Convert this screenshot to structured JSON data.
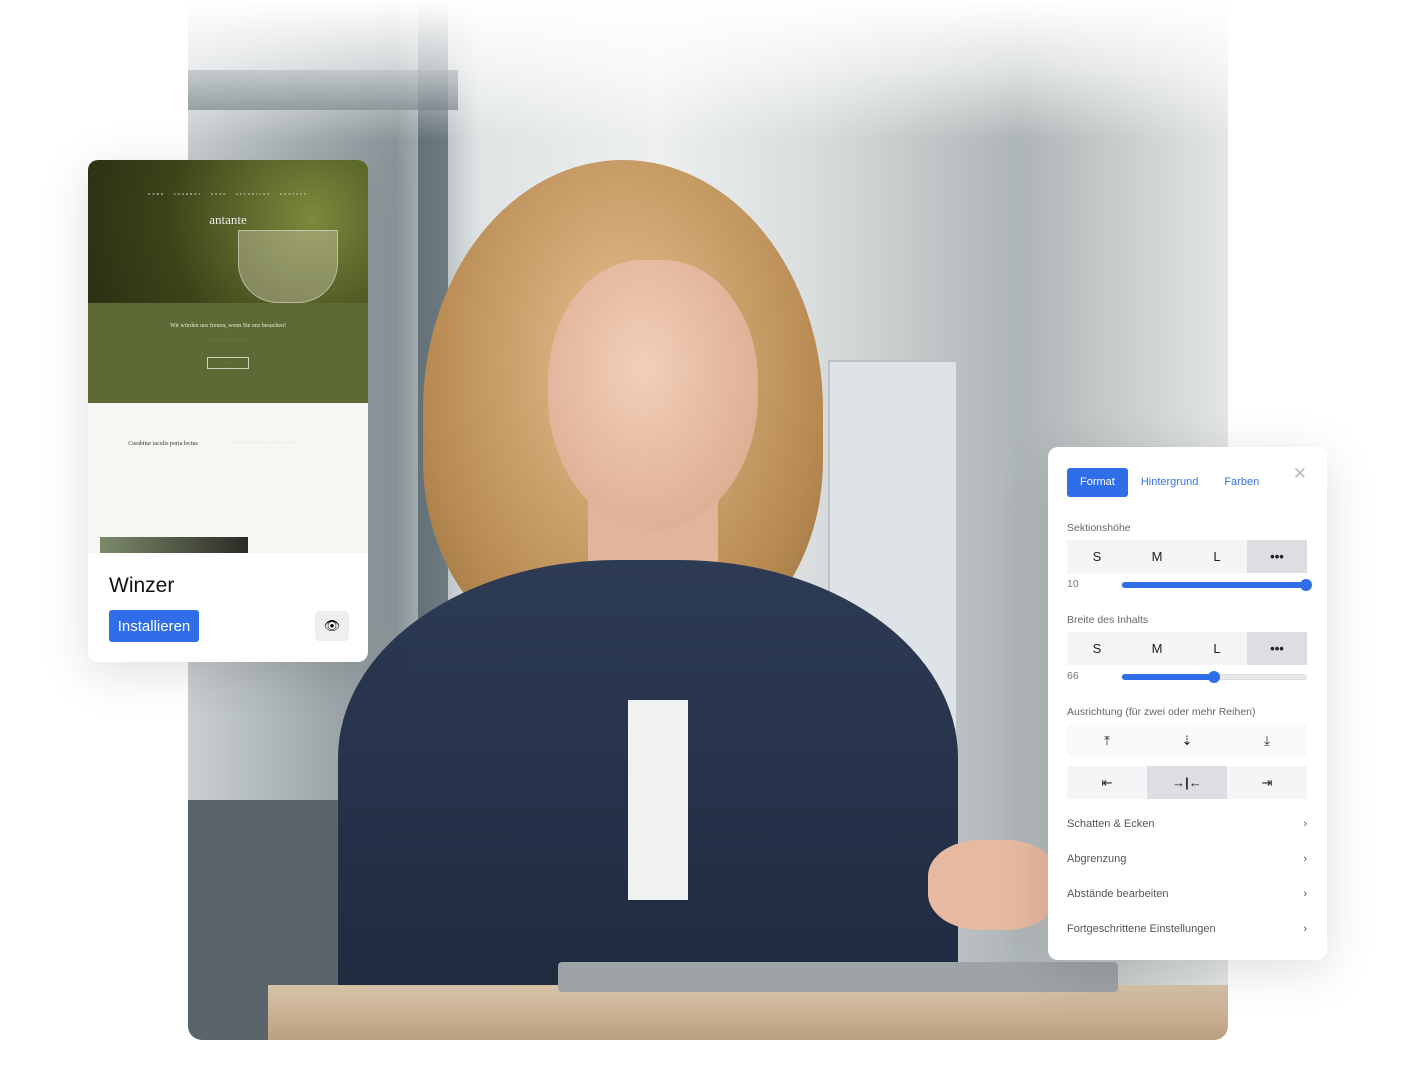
{
  "theme_card": {
    "preview": {
      "logo": "antante",
      "nav": "HOME · ANGEBOT · SHOP · AKTUELLES · KONTAKT",
      "headline": "Wir würden uns freuen, wenn Sie uns besuchen!",
      "section_title": "Curabitur iaculis porta lectus"
    },
    "name": "Winzer",
    "install_label": "Installieren",
    "preview_icon": "eye-icon"
  },
  "panel": {
    "tabs": [
      {
        "label": "Format",
        "active": true
      },
      {
        "label": "Hintergrund"
      },
      {
        "label": "Farben"
      }
    ],
    "close_icon": "close-icon",
    "section_height": {
      "label": "Sektionshöhe",
      "options": [
        "S",
        "M",
        "L",
        "•••"
      ],
      "selected": "•••",
      "value": "10",
      "slider_fraction": 1.0
    },
    "content_width": {
      "label": "Breite des Inhalts",
      "options": [
        "S",
        "M",
        "L",
        "•••"
      ],
      "selected": "•••",
      "value": "66",
      "slider_fraction": 0.5
    },
    "alignment": {
      "label": "Ausrichtung (für zwei oder mehr Reihen)",
      "vertical": [
        "align-top-icon",
        "align-middle-icon",
        "align-bottom-icon"
      ],
      "horizontal": [
        "align-left-icon",
        "align-center-icon",
        "align-right-icon"
      ],
      "horizontal_selected": 1
    },
    "rows": [
      {
        "label": "Schatten & Ecken"
      },
      {
        "label": "Abgrenzung"
      },
      {
        "label": "Abstände bearbeiten"
      },
      {
        "label": "Fortgeschrittene Einstellungen"
      }
    ],
    "accent": "#2f6ee8"
  }
}
